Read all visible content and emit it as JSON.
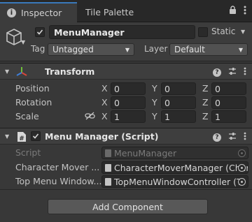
{
  "tabs": [
    {
      "label": "Inspector",
      "icon": "info-icon",
      "active": true
    },
    {
      "label": "Tile Palette",
      "active": false
    }
  ],
  "gameobject": {
    "active": true,
    "name": "MenuManager",
    "static_label": "Static",
    "static_checked": false,
    "tag_label": "Tag",
    "tag_value": "Untagged",
    "layer_label": "Layer",
    "layer_value": "Default"
  },
  "transform": {
    "title": "Transform",
    "rows": [
      {
        "label": "Position",
        "x": "0",
        "y": "0",
        "z": "0"
      },
      {
        "label": "Rotation",
        "x": "0",
        "y": "0",
        "z": "0"
      },
      {
        "label": "Scale",
        "x": "1",
        "y": "1",
        "z": "1"
      }
    ],
    "axis_labels": {
      "x": "X",
      "y": "Y",
      "z": "Z"
    }
  },
  "script_component": {
    "title": "Menu Manager (Script)",
    "enabled": true,
    "fields": [
      {
        "label": "Script",
        "value": "MenuManager",
        "disabled": true
      },
      {
        "label": "Character Mover ...",
        "value": "CharacterMoverManager (Char",
        "disabled": false
      },
      {
        "label": "Top Menu Window...",
        "value": "TopMenuWindowController (To",
        "disabled": false
      }
    ]
  },
  "add_component_label": "Add Component",
  "colors": {
    "background": "#383838",
    "tab_accent": "#3a79bb",
    "field_bg": "#2a2a2a"
  }
}
